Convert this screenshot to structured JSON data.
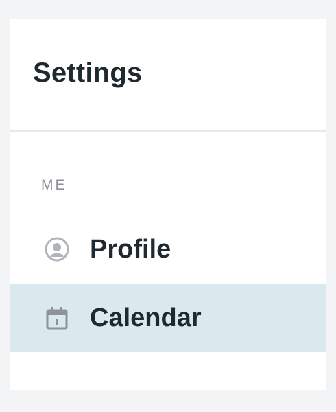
{
  "header": {
    "title": "Settings"
  },
  "section": {
    "label": "ME"
  },
  "menu": {
    "items": [
      {
        "label": "Profile",
        "icon": "user-circle-icon",
        "active": false
      },
      {
        "label": "Calendar",
        "icon": "calendar-icon",
        "active": true
      }
    ]
  },
  "colors": {
    "page_background": "#f3f4f6",
    "panel_background": "#ffffff",
    "active_item_background": "#d9e9ee",
    "text": "#1f2a30",
    "muted_text": "#8b9196",
    "icon": "#b0b4b8"
  }
}
